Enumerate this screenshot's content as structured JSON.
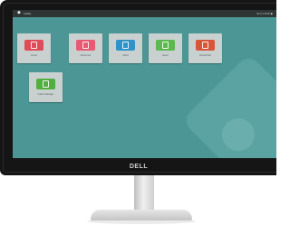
{
  "device": {
    "brand_label": "DELL"
  },
  "topbar": {
    "label": "Lobby",
    "tray": "⊞ ⎙ 12:00 ◉"
  },
  "tiles": [
    {
      "caption": "Lorem",
      "color": "#e04b58"
    },
    {
      "caption": "Document",
      "color": "#e85a72"
    },
    {
      "caption": "Word",
      "color": "#2f93c9"
    },
    {
      "caption": "Excel",
      "color": "#5db84f"
    },
    {
      "caption": "PowerPoint",
      "color": "#d8553a"
    },
    {
      "caption": "Folder Manager",
      "color": "#53ae42"
    }
  ],
  "colors": {
    "desktop": "#4c9695",
    "bezel": "#151515"
  }
}
